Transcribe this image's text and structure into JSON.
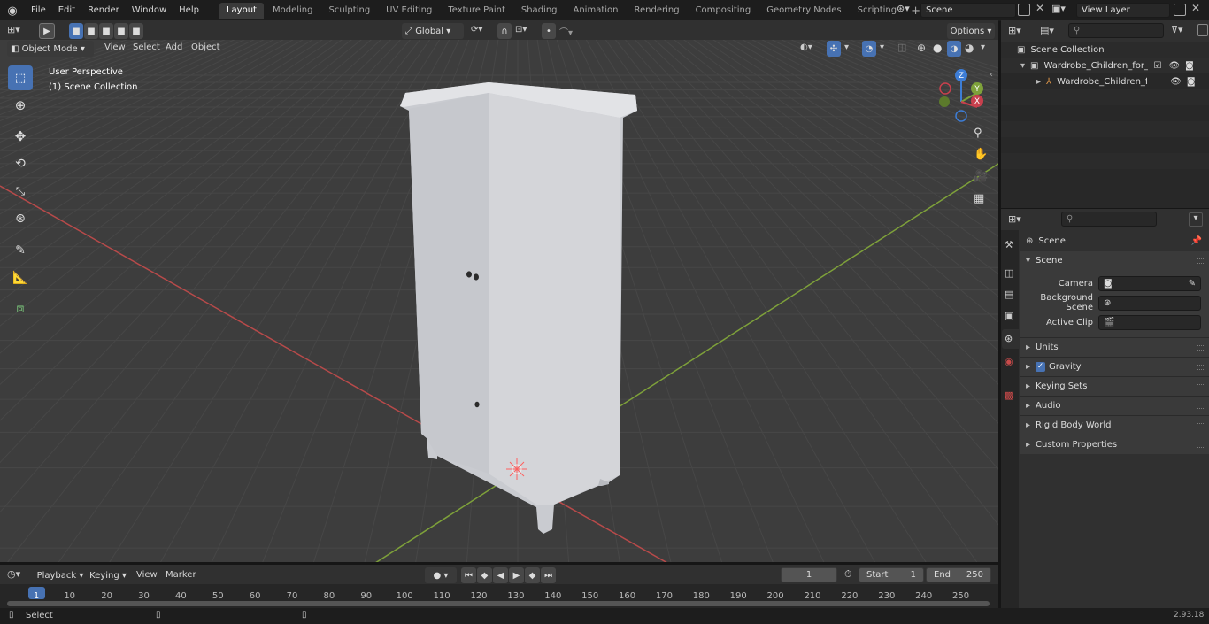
{
  "menu": [
    "File",
    "Edit",
    "Render",
    "Window",
    "Help"
  ],
  "workspaces": [
    {
      "label": "Layout",
      "active": true
    },
    {
      "label": "Modeling"
    },
    {
      "label": "Sculpting"
    },
    {
      "label": "UV Editing"
    },
    {
      "label": "Texture Paint"
    },
    {
      "label": "Shading"
    },
    {
      "label": "Animation"
    },
    {
      "label": "Rendering"
    },
    {
      "label": "Compositing"
    },
    {
      "label": "Geometry Nodes"
    },
    {
      "label": "Scripting"
    }
  ],
  "scene_name": "Scene",
  "view_layer": "View Layer",
  "viewport_header": {
    "mode": "Object Mode",
    "menus": [
      "View",
      "Select",
      "Add",
      "Object"
    ],
    "orientation": "Global",
    "options": "Options"
  },
  "overlay": {
    "perspective": "User Perspective",
    "collection": "(1) Scene Collection"
  },
  "gizmo": {
    "z": "Z",
    "y": "Y",
    "x": "X"
  },
  "outliner": {
    "root": "Scene Collection",
    "items": [
      "Wardrobe_Children_for_Room",
      "Wardrobe_Children_for_F"
    ]
  },
  "properties": {
    "context": "Scene",
    "section": "Scene",
    "fields": [
      {
        "label": "Camera"
      },
      {
        "label": "Background Scene"
      },
      {
        "label": "Active Clip"
      }
    ],
    "panels": [
      "Units",
      "Gravity",
      "Keying Sets",
      "Audio",
      "Rigid Body World",
      "Custom Properties"
    ]
  },
  "timeline": {
    "menus": [
      "Playback",
      "Keying",
      "View",
      "Marker"
    ],
    "current_frame": "1",
    "start_label": "Start",
    "start": "1",
    "end_label": "End",
    "end": "250",
    "ticks": [
      "1",
      "10",
      "20",
      "30",
      "40",
      "50",
      "60",
      "70",
      "80",
      "90",
      "100",
      "110",
      "120",
      "130",
      "140",
      "150",
      "160",
      "170",
      "180",
      "190",
      "200",
      "210",
      "220",
      "230",
      "240",
      "250"
    ]
  },
  "status": {
    "left": "Select",
    "version": "2.93.18"
  },
  "colors": {
    "accent": "#4772b3",
    "x_axis": "#b84a4a",
    "y_axis": "#7ea13a",
    "z_axis": "#3d7dd6",
    "viewport": "#3d3d3d"
  }
}
